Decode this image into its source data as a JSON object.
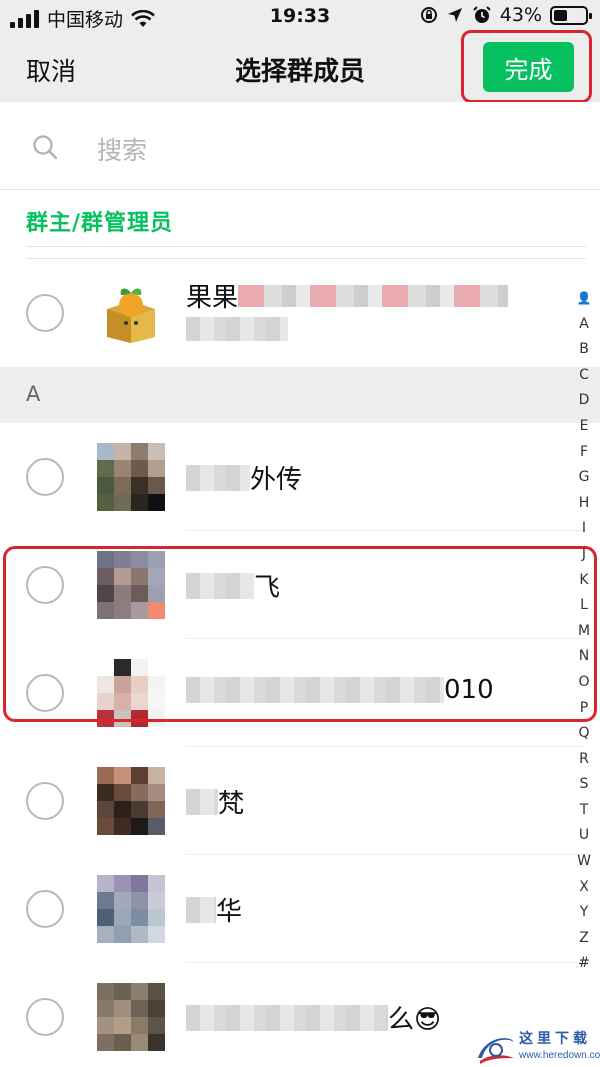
{
  "status_bar": {
    "carrier": "中国移动",
    "time": "19:33",
    "battery_percent": "43%",
    "battery_level": 0.43
  },
  "nav": {
    "cancel_label": "取消",
    "title": "选择群成员",
    "done_label": "完成",
    "accent_color": "#07c160"
  },
  "search": {
    "placeholder": "搜索"
  },
  "admin_section": {
    "header": "群主/群管理员",
    "members": [
      {
        "name_visible": "果果"
      }
    ]
  },
  "section_a": {
    "letter": "A",
    "members": [
      {
        "name_visible": "外传"
      },
      {
        "name_visible": "飞"
      },
      {
        "name_visible": "010"
      },
      {
        "name_visible": "梵"
      },
      {
        "name_visible": "华"
      },
      {
        "name_visible": "么😎"
      }
    ]
  },
  "index_bar": [
    "👤",
    "A",
    "B",
    "C",
    "D",
    "E",
    "F",
    "G",
    "H",
    "I",
    "J",
    "K",
    "L",
    "M",
    "N",
    "O",
    "P",
    "Q",
    "R",
    "S",
    "T",
    "U",
    "W",
    "X",
    "Y",
    "Z",
    "#"
  ],
  "watermark": {
    "text": "这里下载",
    "url": "www.heredown.com"
  },
  "highlight_color": "#d9262e"
}
